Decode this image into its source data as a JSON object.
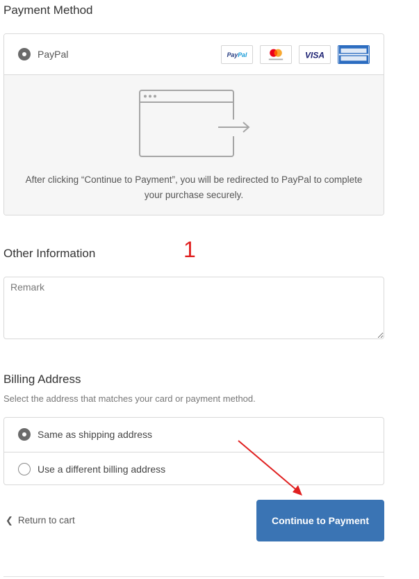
{
  "payment": {
    "title": "Payment Method",
    "option_label": "PayPal",
    "selected": true,
    "cards": [
      "paypal",
      "mastercard",
      "visa",
      "american-express"
    ],
    "redirect_text": "After clicking “Continue to Payment”, you will be redirected to PayPal to complete your purchase securely."
  },
  "annotations": {
    "step_number": "1",
    "color": "#e02020"
  },
  "other_info": {
    "title": "Other Information",
    "remark_placeholder": "Remark",
    "remark_value": ""
  },
  "billing": {
    "title": "Billing Address",
    "subtitle": "Select the address that matches your card or payment method.",
    "options": [
      {
        "label": "Same as shipping address",
        "selected": true
      },
      {
        "label": "Use a different billing address",
        "selected": false
      }
    ]
  },
  "footer": {
    "return_label": "Return to cart",
    "continue_label": "Continue to Payment"
  },
  "colors": {
    "accent": "#3a74b4",
    "border": "#d9d9d9",
    "panel_bg": "#f6f6f6",
    "annotation": "#e02020"
  }
}
